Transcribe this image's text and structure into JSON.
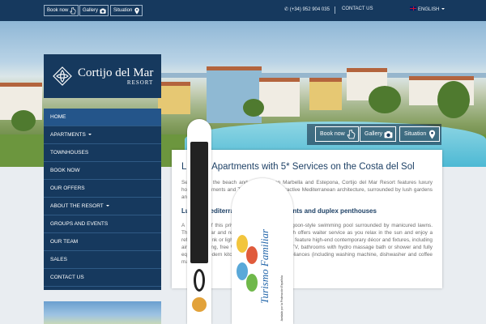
{
  "topbar": {
    "book_now": "Book now",
    "gallery": "Gallery",
    "situation": "Situation",
    "phone": "(+34) 952 904 035",
    "contact": "CONTACT US",
    "language": "ENGLISH"
  },
  "logo": {
    "name": "Cortijo del Mar",
    "sub": "RESORT"
  },
  "nav": {
    "items": [
      {
        "label": "HOME"
      },
      {
        "label": "APARTMENTS"
      },
      {
        "label": "TOWNHOUSES"
      },
      {
        "label": "BOOK NOW"
      },
      {
        "label": "OUR OFFERS"
      },
      {
        "label": "ABOUT THE RESORT"
      },
      {
        "label": "GROUPS AND EVENTS"
      },
      {
        "label": "OUR TEAM"
      },
      {
        "label": "SALES"
      },
      {
        "label": "CONTACT US"
      }
    ]
  },
  "overlay": {
    "book_now": "Book now",
    "gallery": "Gallery",
    "situation": "Situation"
  },
  "content": {
    "title": "Luxury Apartments with 5* Services on the Costa del Sol",
    "p1": "Set close to the beach and golf between Marbella and Estepona, Cortijo del Mar Resort features luxury holiday apartments and Townhouses with attractive Mediterranean architecture, surrounded by lush gardens and pools.",
    "subtitle": "Luxury Mediterranean style apartments and duplex penthouses",
    "p2": "A highlight of this private resort is the large lagoon-style swimming pool surrounded by manicured lawns. There is a bar and restaurant by the pool which offers waiter service as you relax in the sun and enjoy a refreshing drink or light meal. The apartments all feature high-end contemporary décor and fixtures, including air conditioning, free Wi-Fi, satellite flat screen TV, bathrooms with hydro massage bath or shower and fully equipped modern kitchens with high quality appliances (including washing machine, dishwasher and coffee machine)."
  },
  "banner": {
    "text": "Turismo Familiar",
    "small": "Avalado por la Federación Española"
  },
  "colors": {
    "navy": "#16395e",
    "nav_active": "#24558a",
    "title": "#1e4166"
  }
}
